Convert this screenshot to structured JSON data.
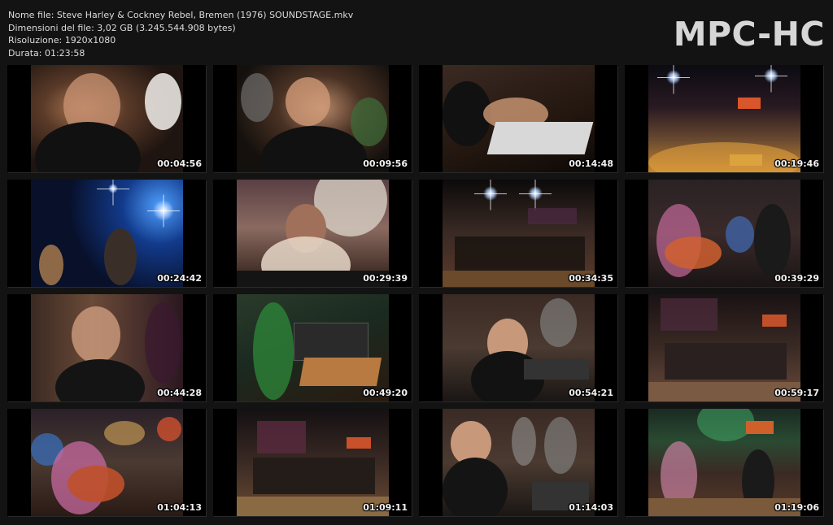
{
  "header": {
    "file_name": "Nome file: Steve Harley & Cockney Rebel, Bremen (1976) SOUNDSTAGE.mkv",
    "file_size": "Dimensioni del file: 3,02 GB (3.245.544.908 bytes)",
    "resolution": "Risoluzione: 1920x1080",
    "duration": "Durata: 01:23:58",
    "logo": "MPC-HC"
  },
  "thumbnails": [
    {
      "time": "00:04:56"
    },
    {
      "time": "00:09:56"
    },
    {
      "time": "00:14:48"
    },
    {
      "time": "00:19:46"
    },
    {
      "time": "00:24:42"
    },
    {
      "time": "00:29:39"
    },
    {
      "time": "00:34:35"
    },
    {
      "time": "00:39:29"
    },
    {
      "time": "00:44:28"
    },
    {
      "time": "00:49:20"
    },
    {
      "time": "00:54:21"
    },
    {
      "time": "00:59:17"
    },
    {
      "time": "01:04:13"
    },
    {
      "time": "01:09:11"
    },
    {
      "time": "01:14:03"
    },
    {
      "time": "01:19:06"
    }
  ]
}
